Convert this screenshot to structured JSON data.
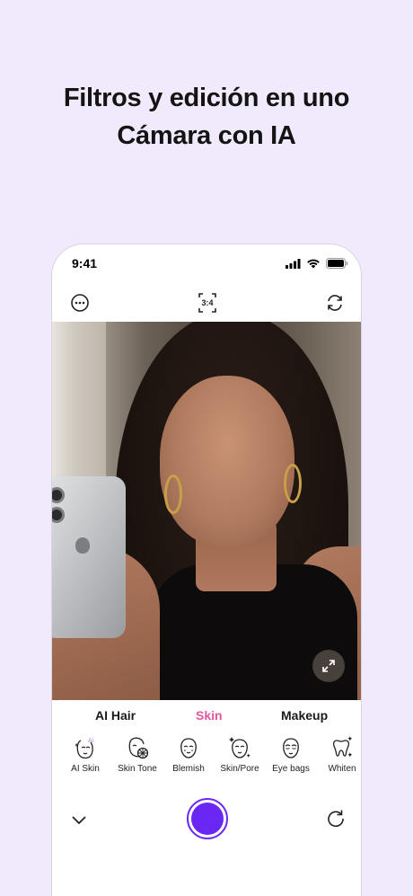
{
  "headline": {
    "line1": "Filtros y edición en uno",
    "line2": "Cámara con IA"
  },
  "status_bar": {
    "time": "9:41"
  },
  "toolbar": {
    "aspect_ratio": "3:4",
    "icons": [
      "more-icon",
      "aspect-ratio-icon",
      "switch-camera-icon"
    ]
  },
  "tabs": [
    {
      "label": "AI Hair",
      "active": false
    },
    {
      "label": "Skin",
      "active": true
    },
    {
      "label": "Makeup",
      "active": false
    }
  ],
  "tools": [
    {
      "label": "AI Skin",
      "icon": "ai-skin-icon"
    },
    {
      "label": "Skin Tone",
      "icon": "skin-tone-icon"
    },
    {
      "label": "Blemish",
      "icon": "blemish-icon"
    },
    {
      "label": "Skin/Pore",
      "icon": "skin-pore-icon"
    },
    {
      "label": "Eye bags",
      "icon": "eye-bags-icon"
    },
    {
      "label": "Whiten",
      "icon": "whiten-icon"
    }
  ],
  "colors": {
    "background": "#f1eafc",
    "accent_tab": "#e4579d",
    "shutter": "#6a26f2"
  }
}
